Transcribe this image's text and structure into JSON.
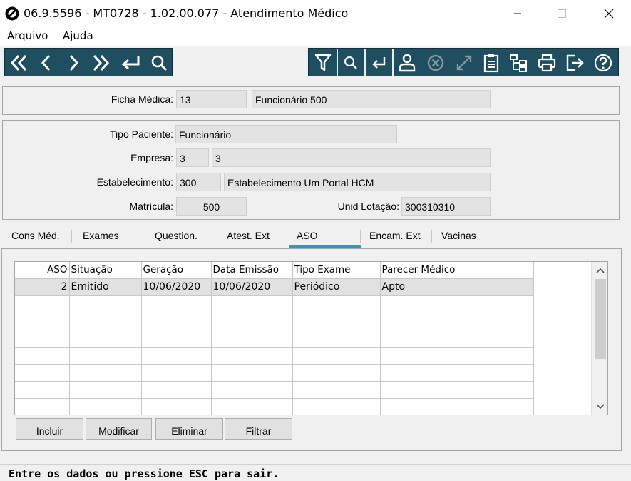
{
  "window": {
    "title": "06.9.5596 - MT0728 - 1.02.00.077 - Atendimento Médico",
    "controls": [
      "minimize-icon",
      "maximize-icon",
      "close-icon"
    ]
  },
  "menu": {
    "items": [
      "Arquivo",
      "Ajuda"
    ]
  },
  "toolbar": {
    "nav_icons": [
      "first-icon",
      "previous-icon",
      "next-icon",
      "last-icon",
      "goto-icon",
      "search-icon"
    ],
    "action_icons": [
      "filter-icon",
      "query-icon",
      "return-icon",
      "user-icon",
      "cancel-icon",
      "expand-icon",
      "clipboard-icon",
      "tree-icon",
      "print-icon",
      "exit-icon",
      "help-icon"
    ],
    "color": "#1f4e61"
  },
  "header": {
    "ficha_label": "Ficha Médica:",
    "ficha_value": "13",
    "ficha_desc": "Funcionário 500"
  },
  "details": {
    "tipo_label": "Tipo Paciente:",
    "tipo_value": "Funcionário",
    "empresa_label": "Empresa:",
    "empresa_code": "3",
    "empresa_name": "3",
    "estab_label": "Estabelecimento:",
    "estab_code": "300",
    "estab_name": "Estabelecimento Um Portal HCM",
    "matricula_label": "Matrícula:",
    "matricula_value": "500",
    "lotacao_label": "Unid Lotação:",
    "lotacao_value": "300310310"
  },
  "tabs": [
    "Cons Méd.",
    "Exames",
    "Question.",
    "Atest. Ext",
    "ASO",
    "Encam. Ext",
    "Vacinas"
  ],
  "active_tab": "ASO",
  "accent_color": "#1a9fd6",
  "grid": {
    "columns": [
      "ASO",
      "Situação",
      "Geração",
      "Data Emissão",
      "Tipo Exame",
      "Parecer Médico"
    ],
    "rows": [
      [
        "2",
        "Emitido",
        "10/06/2020",
        "10/06/2020",
        "Periódico",
        "Apto"
      ]
    ]
  },
  "buttons": [
    "Incluir",
    "Modificar",
    "Eliminar",
    "Filtrar"
  ],
  "status": "Entre os dados ou pressione ESC para sair."
}
